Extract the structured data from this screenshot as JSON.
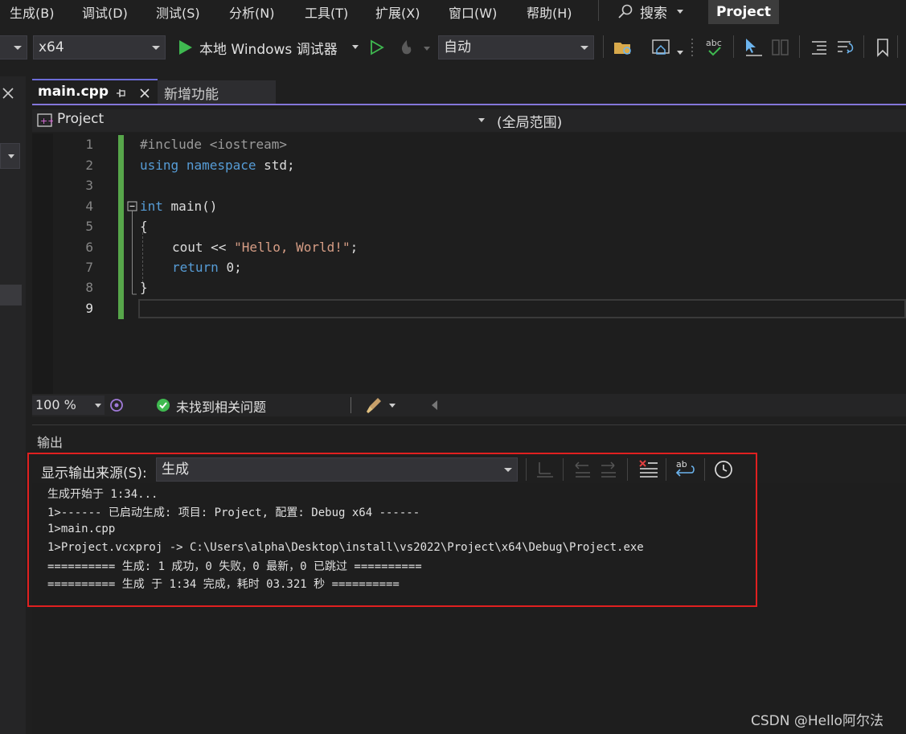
{
  "menu": {
    "items": [
      "生成(B)",
      "调试(D)",
      "测试(S)",
      "分析(N)",
      "工具(T)",
      "扩展(X)",
      "窗口(W)",
      "帮助(H)"
    ],
    "search_label": "搜索",
    "project_label": "Project"
  },
  "toolbar": {
    "platform": "x64",
    "debugger": "本地 Windows 调试器",
    "config": "自动"
  },
  "tabs": [
    {
      "label": "main.cpp",
      "active": true
    },
    {
      "label": "新增功能",
      "active": false
    }
  ],
  "nav": {
    "project": "Project",
    "scope": "(全局范围)"
  },
  "editor": {
    "line_numbers": [
      "1",
      "2",
      "3",
      "4",
      "5",
      "6",
      "7",
      "8",
      "9"
    ],
    "code": {
      "l1_directive": "#include",
      "l1_header": "<iostream>",
      "l2_using": "using",
      "l2_namespace": "namespace",
      "l2_rest": "std;",
      "l4_int": "int",
      "l4_main": "main()",
      "l5_brace": "{",
      "l6_cout": "cout <<",
      "l6_string": "\"Hello, World!\"",
      "l6_semi": ";",
      "l7_return": "return",
      "l7_rest": "0;",
      "l8_brace": "}"
    }
  },
  "status": {
    "zoom": "100 %",
    "issues": "未找到相关问题"
  },
  "output": {
    "title": "输出",
    "source_label": "显示输出来源(S):",
    "source_value": "生成",
    "lines": [
      "生成开始于 1:34...",
      "1>------ 已启动生成: 项目: Project, 配置: Debug x64 ------",
      "1>main.cpp",
      "1>Project.vcxproj -> C:\\Users\\alpha\\Desktop\\install\\vs2022\\Project\\x64\\Debug\\Project.exe",
      "========== 生成: 1 成功，0 失败，0 最新，0 已跳过 ==========",
      "========== 生成 于 1:34 完成，耗时 03.321 秒 =========="
    ]
  },
  "watermark": "CSDN @Hello阿尔法",
  "colors": {
    "accent": "#8476d9",
    "highlight_box": "#e02020",
    "keyword": "#569cd6",
    "string": "#d69d85",
    "change_bar": "#57a64a"
  }
}
